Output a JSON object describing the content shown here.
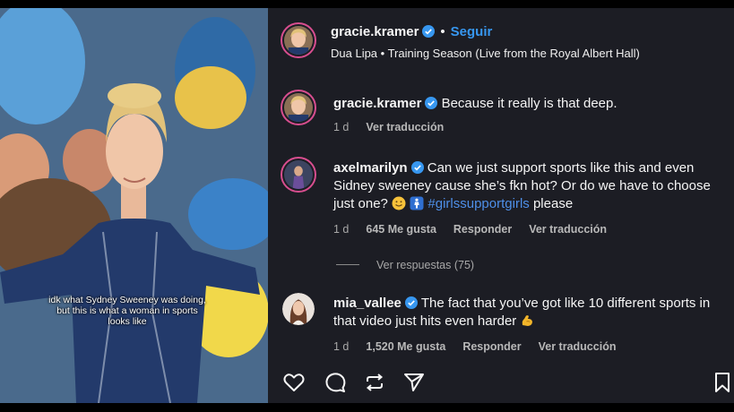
{
  "post": {
    "caption_overlay": "idk what Sydney Sweeney was doing, but this is what a woman in sports looks like"
  },
  "header": {
    "username": "gracie.kramer",
    "follow_label": "Seguir",
    "audio": "Dua Lipa • Training Season (Live from the Royal Albert Hall)"
  },
  "comments": [
    {
      "username": "gracie.kramer",
      "text": "Because it really is that deep.",
      "time": "1 d",
      "translate": "Ver traducción"
    },
    {
      "username": "axelmarilyn",
      "text": "Can we just support sports like this and even Sidney sweeney cause she’s fkn hot? Or do we have to choose just one?",
      "hashtag": "#girlssupportgirls",
      "tail": "please",
      "time": "1 d",
      "likes": "645 Me gusta",
      "reply": "Responder",
      "translate": "Ver traducción"
    },
    {
      "username": "mia_vallee",
      "text": "The fact that you’ve got like 10 different sports in that video just hits even harder",
      "time": "1 d",
      "likes": "1,520 Me gusta",
      "reply": "Responder",
      "translate": "Ver traducción"
    }
  ],
  "view_replies": "Ver respuestas (75)",
  "icons": {
    "like": "heart-icon",
    "comment": "comment-icon",
    "repost": "repost-icon",
    "share": "send-icon",
    "save": "bookmark-icon",
    "verified": "verified-badge-icon"
  },
  "colors": {
    "panel_bg": "#1c1d24",
    "link_blue": "#3797f0",
    "hashtag": "#4e8fe8",
    "muted": "#a8a8a8",
    "story_ring": "#d84e8f"
  }
}
